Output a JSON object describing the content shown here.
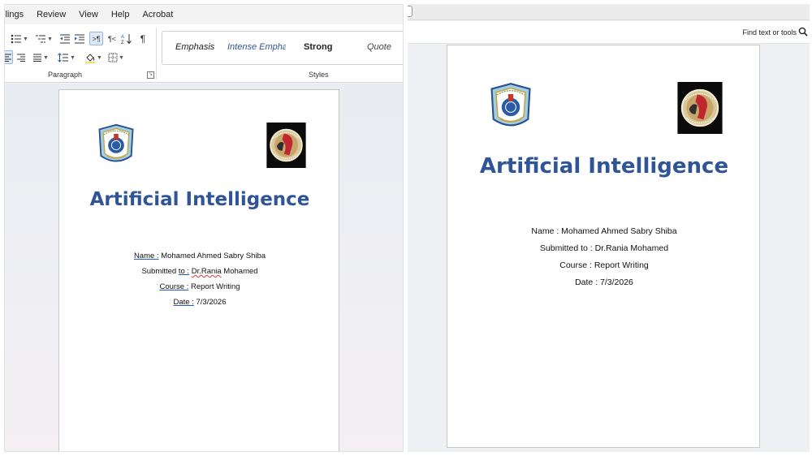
{
  "word": {
    "menu": [
      "ilings",
      "Review",
      "View",
      "Help",
      "Acrobat"
    ],
    "ribbon": {
      "paragraph_label": "Paragraph",
      "styles_label": "Styles",
      "styles": [
        "Emphasis",
        "Intense Empha",
        "Strong",
        "Quote"
      ]
    },
    "document": {
      "title": "Artificial Intelligence",
      "name_label": "Name :",
      "name_value": " Mohamed Ahmed Sabry Shiba",
      "submitted_label_a": "Submitted ",
      "submitted_label_b": "to :",
      "submitted_value_a": "Dr.Rania",
      "submitted_value_b": " Mohamed",
      "course_label": "Course :",
      "course_value": " Report Writing",
      "date_label": "Date :",
      "date_value": " 7/3/2026"
    }
  },
  "viewer": {
    "find_label": "Find text or tools",
    "document": {
      "title": "Artificial Intelligence",
      "name_line": "Name : Mohamed Ahmed Sabry Shiba",
      "submitted_line": "Submitted to : Dr.Rania Mohamed",
      "course_line": "Course : Report Writing",
      "date_line": "Date : 7/3/2026"
    }
  },
  "colors": {
    "title_blue": "#2f5497",
    "intense_emphasis_blue": "#2f5597",
    "proofing_squiggle": "#d23b3b"
  },
  "icons": [
    "bullets-icon",
    "multilevel-list-icon",
    "decrease-indent-icon",
    "increase-indent-icon",
    "ltr-paragraph-icon",
    "rtl-paragraph-icon",
    "sort-icon",
    "pilcrow-icon",
    "align-left-icon",
    "align-right-icon",
    "justify-icon",
    "line-spacing-icon",
    "shading-icon",
    "borders-icon",
    "dialog-launcher-icon",
    "search-icon",
    "university-crest-logo",
    "faculty-crest-logo"
  ]
}
